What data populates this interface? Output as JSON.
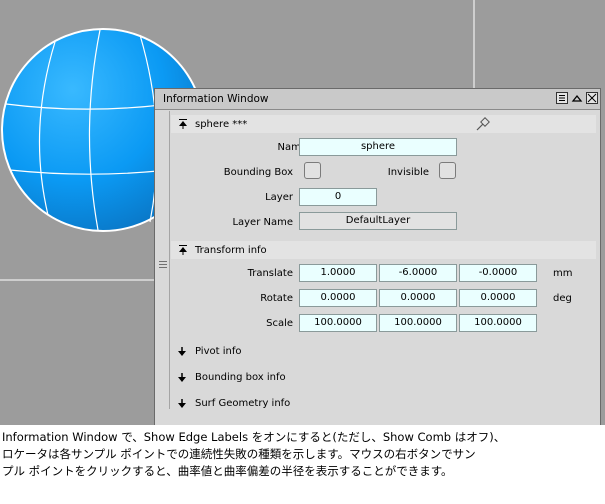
{
  "window": {
    "title": "Information Window"
  },
  "object_section": {
    "header": "sphere ***",
    "name_label": "Name",
    "name_value": "sphere",
    "bounding_box_label": "Bounding Box",
    "invisible_label": "Invisible",
    "layer_label": "Layer",
    "layer_value": "0",
    "layer_name_label": "Layer Name",
    "layer_name_value": "DefaultLayer"
  },
  "transform_section": {
    "header": "Transform info",
    "translate_label": "Translate",
    "translate": [
      "1.0000",
      "-6.0000",
      "-0.0000"
    ],
    "translate_unit": "mm",
    "rotate_label": "Rotate",
    "rotate": [
      "0.0000",
      "0.0000",
      "0.0000"
    ],
    "rotate_unit": "deg",
    "scale_label": "Scale",
    "scale": [
      "100.0000",
      "100.0000",
      "100.0000"
    ]
  },
  "collapsed_sections": [
    "Pivot info",
    "Bounding box info",
    "Surf Geometry info"
  ],
  "caption": {
    "line1": "Information Window で、Show Edge Labels をオンにすると(ただし、Show Comb はオフ)、",
    "line2": "ロケータは各サンプル ポイントでの連続性失敗の種類を示します。マウスの右ボタンでサン",
    "line3": "プル ポイントをクリックすると、曲率値と曲率偏差の半径を表示することができます。"
  },
  "colors": {
    "viewport_bg": "#9c9c9c",
    "sphere": "#0f9cf5",
    "field_bg": "#eaffff",
    "window_bg": "#d9d9d9"
  }
}
